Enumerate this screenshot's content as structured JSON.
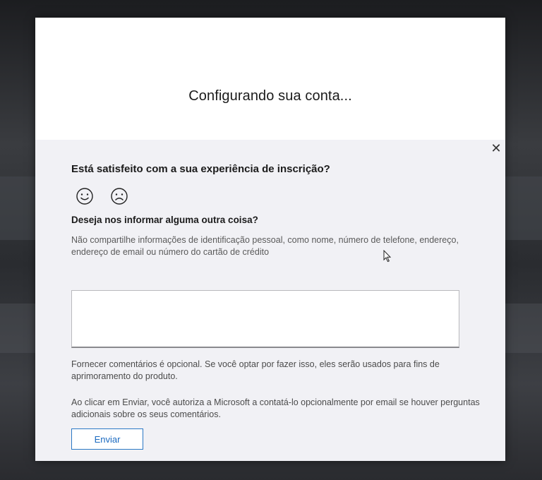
{
  "dialog": {
    "title": "Configurando sua conta..."
  },
  "feedback": {
    "close_icon": "close-icon",
    "satisfaction_question": "Está satisfeito com a sua experiência de inscrição?",
    "rating_options": [
      {
        "icon": "smiley-face-icon"
      },
      {
        "icon": "frowning-face-icon"
      }
    ],
    "other_question": "Deseja nos informar alguma outra coisa?",
    "privacy_note": "Não compartilhe informações de identificação pessoal, como nome, número de telefone, endereço, endereço de email ou número do cartão de crédito",
    "comment_value": "",
    "optional_note": "Fornecer comentários é opcional. Se você optar por fazer isso, eles serão usados para fins de aprimoramento do produto.",
    "consent_note": "Ao clicar em Enviar, você autoriza a Microsoft a contatá-lo opcionalmente por email se houver perguntas adicionais sobre os seus comentários.",
    "submit_label": "Enviar"
  },
  "colors": {
    "panel_bg": "#f1f1f5",
    "accent": "#1b6ac0"
  }
}
